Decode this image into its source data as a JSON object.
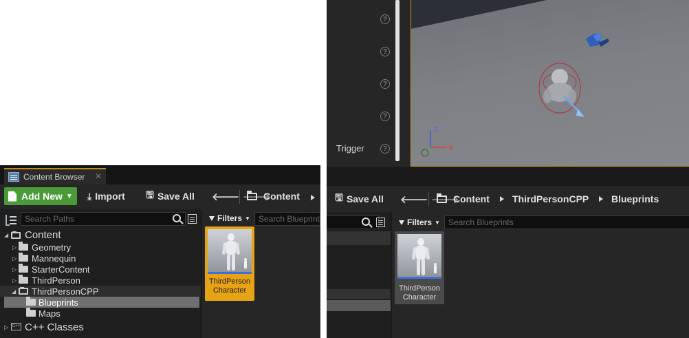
{
  "left_panel": {
    "tab_title": "Content Browser",
    "tab_close": "✕",
    "toolbar": {
      "add_new_label": "Add New",
      "import_label": "Import",
      "save_all_label": "Save All",
      "breadcrumb_root": "Content"
    },
    "search_paths_placeholder": "Search Paths",
    "tree": [
      {
        "label": "Content",
        "expanded": true
      },
      {
        "label": "Geometry"
      },
      {
        "label": "Mannequin"
      },
      {
        "label": "StarterContent"
      },
      {
        "label": "ThirdPerson"
      },
      {
        "label": "ThirdPersonCPP",
        "expanded": true
      },
      {
        "label": "Blueprints",
        "selected": true
      },
      {
        "label": "Maps"
      },
      {
        "label": "C++ Classes"
      }
    ],
    "filters_label": "Filters",
    "search_blueprints_placeholder": "Search Blueprint",
    "asset": {
      "name_line1": "ThirdPerson",
      "name_line2": "Character",
      "selected": true
    }
  },
  "right_panel": {
    "details": {
      "trigger_label": "Trigger",
      "help_icon_glyph": "?"
    },
    "viewport": {
      "axis_z": "Z",
      "axis_x": "X"
    },
    "toolbar": {
      "save_all_label": "Save All",
      "breadcrumb": [
        "Content",
        "ThirdPersonCPP",
        "Blueprints"
      ]
    },
    "filters_label": "Filters",
    "search_blueprints_placeholder": "Search Blueprints",
    "asset": {
      "name_line1": "ThirdPerson",
      "name_line2": "Character"
    }
  },
  "colors": {
    "add_new_green": "#4a9a3a",
    "selection_orange": "#e6a316",
    "asset_bar_blue": "#3d6fd8",
    "tab_accent": "#c08a20"
  }
}
